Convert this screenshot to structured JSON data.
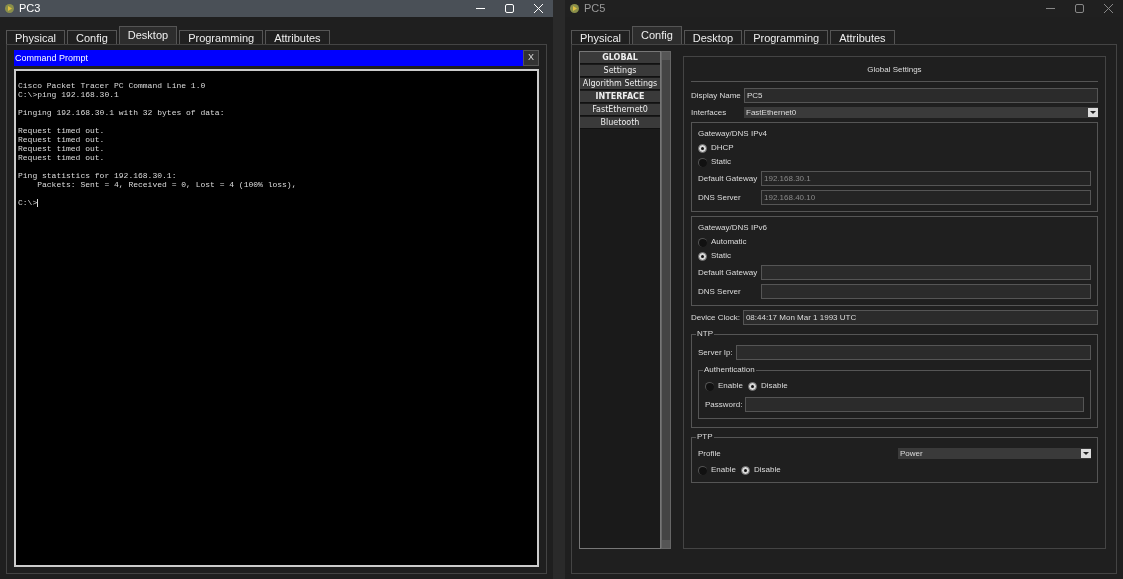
{
  "windows": [
    {
      "kind": "terminal",
      "title": "PC3",
      "active": true,
      "tabs": [
        {
          "label": "Physical",
          "selected": false
        },
        {
          "label": "Config",
          "selected": false
        },
        {
          "label": "Desktop",
          "selected": true
        },
        {
          "label": "Programming",
          "selected": false
        },
        {
          "label": "Attributes",
          "selected": false
        }
      ],
      "terminal": {
        "title": "Command Prompt",
        "close_label": "X",
        "blocks": [
          [
            "Cisco Packet Tracer PC Command Line 1.0",
            "C:\\>ping 192.168.30.1"
          ],
          [
            "Pinging 192.168.30.1 with 32 bytes of data:"
          ],
          [
            "Request timed out.",
            "Request timed out.",
            "Request timed out.",
            "Request timed out."
          ],
          [
            "Ping statistics for 192.168.30.1:",
            "    Packets: Sent = 4, Received = 0, Lost = 4 (100% loss),"
          ],
          [
            "C:\\>"
          ]
        ]
      }
    },
    {
      "kind": "config",
      "title": "PC5",
      "active": false,
      "tabs": [
        {
          "label": "Physical",
          "selected": false
        },
        {
          "label": "Config",
          "selected": true
        },
        {
          "label": "Desktop",
          "selected": false
        },
        {
          "label": "Programming",
          "selected": false
        },
        {
          "label": "Attributes",
          "selected": false
        }
      ],
      "config": {
        "sidebar": [
          {
            "kind": "header",
            "label": "GLOBAL"
          },
          {
            "kind": "item",
            "label": "Settings"
          },
          {
            "kind": "item",
            "label": "Algorithm Settings"
          },
          {
            "kind": "header",
            "label": "INTERFACE"
          },
          {
            "kind": "item",
            "label": "FastEthernet0"
          },
          {
            "kind": "item",
            "label": "Bluetooth"
          }
        ],
        "heading": "Global Settings",
        "display_name": {
          "label": "Display Name",
          "value": "PC5"
        },
        "interfaces": {
          "label": "Interfaces",
          "value": "FastEthernet0"
        },
        "ipv4": {
          "title": "Gateway/DNS IPv4",
          "options": [
            {
              "label": "DHCP",
              "selected": true
            },
            {
              "label": "Static",
              "selected": false
            }
          ],
          "fields": [
            {
              "label": "Default Gateway",
              "value": "192.168.30.1",
              "disabled": true
            },
            {
              "label": "DNS Server",
              "value": "192.168.40.10",
              "disabled": true
            }
          ]
        },
        "ipv6": {
          "title": "Gateway/DNS IPv6",
          "options": [
            {
              "label": "Automatic",
              "selected": false
            },
            {
              "label": "Static",
              "selected": true
            }
          ],
          "fields": [
            {
              "label": "Default Gateway"
            },
            {
              "label": "DNS Server"
            }
          ]
        },
        "device_clock": {
          "label": "Device Clock:",
          "value": "08:44:17 Mon Mar 1 1993 UTC"
        },
        "ntp": {
          "title": "NTP",
          "server": {
            "label": "Server Ip:"
          },
          "authentication": {
            "title": "Authentication",
            "options": [
              {
                "label": "Enable",
                "selected": false
              },
              {
                "label": "Disable",
                "selected": true
              }
            ],
            "password": {
              "label": "Password:"
            }
          }
        },
        "ptp": {
          "title": "PTP",
          "profile": {
            "label": "Profile",
            "value": "Power"
          },
          "options": [
            {
              "label": "Enable",
              "selected": false
            },
            {
              "label": "Disable",
              "selected": true
            }
          ]
        }
      }
    }
  ]
}
